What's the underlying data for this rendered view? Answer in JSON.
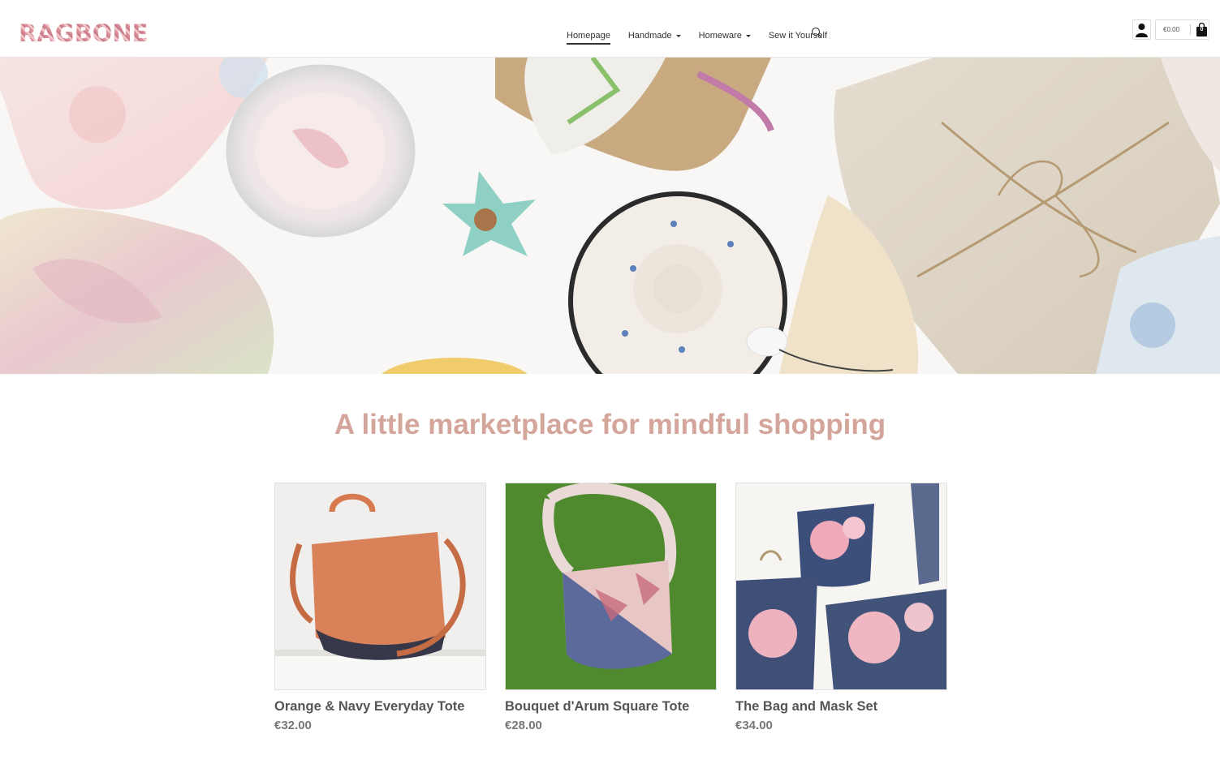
{
  "brand": {
    "logo_text": "RAGBONE"
  },
  "nav": {
    "items": [
      {
        "label": "Homepage",
        "active": true,
        "has_dropdown": false
      },
      {
        "label": "Handmade",
        "active": false,
        "has_dropdown": true
      },
      {
        "label": "Homeware",
        "active": false,
        "has_dropdown": true
      },
      {
        "label": "Sew it Yourself",
        "active": false,
        "has_dropdown": false
      }
    ],
    "search_icon": "search-icon"
  },
  "account": {
    "icon": "user-icon"
  },
  "cart": {
    "total": "€0.00",
    "count": "0",
    "icon": "shopping-bag-icon"
  },
  "hero": {
    "icon": "hero-banner-image"
  },
  "tagline": "A little marketplace for mindful shopping",
  "products": [
    {
      "title": "Orange & Navy Everyday Tote",
      "price": "€32.00"
    },
    {
      "title": "Bouquet d'Arum Square Tote",
      "price": "€28.00"
    },
    {
      "title": "The Bag and Mask Set",
      "price": "€34.00"
    }
  ],
  "colors": {
    "accent": "#d4a69b",
    "logo": "#e2a4a9",
    "text": "#333333"
  }
}
